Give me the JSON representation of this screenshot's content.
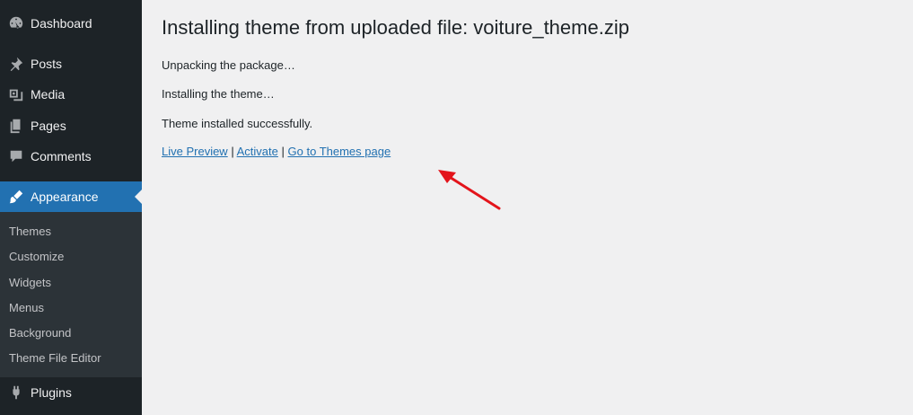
{
  "sidebar": {
    "items": [
      {
        "label": "Dashboard",
        "icon": "dashboard-icon"
      },
      {
        "label": "Posts",
        "icon": "pin-icon"
      },
      {
        "label": "Media",
        "icon": "media-icon"
      },
      {
        "label": "Pages",
        "icon": "pages-icon"
      },
      {
        "label": "Comments",
        "icon": "comment-icon"
      },
      {
        "label": "Appearance",
        "icon": "brush-icon",
        "active": true
      },
      {
        "label": "Plugins",
        "icon": "plug-icon"
      }
    ],
    "submenu": [
      "Themes",
      "Customize",
      "Widgets",
      "Menus",
      "Background",
      "Theme File Editor"
    ]
  },
  "main": {
    "title": "Installing theme from uploaded file: voiture_theme.zip",
    "messages": [
      "Unpacking the package…",
      "Installing the theme…",
      "Theme installed successfully."
    ],
    "links": {
      "live_preview": "Live Preview",
      "activate": "Activate",
      "themes_page": "Go to Themes page",
      "separator": "|"
    }
  },
  "colors": {
    "sidebar_bg": "#1d2327",
    "submenu_bg": "#2c3338",
    "accent": "#2271b1",
    "content_bg": "#f0f0f1",
    "annotation_arrow": "#e3141b"
  }
}
